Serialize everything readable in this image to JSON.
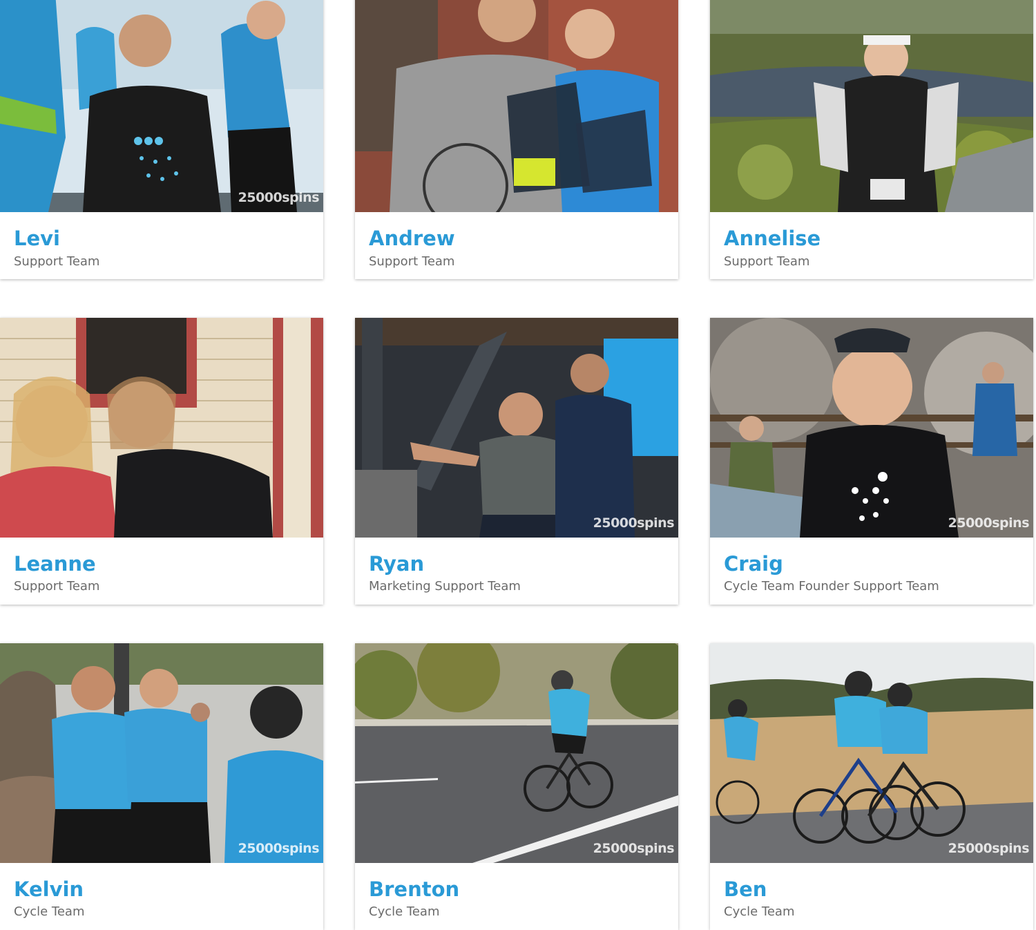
{
  "team": {
    "members": [
      {
        "name": "Levi",
        "role": "Support Team",
        "watermark": "25000spins"
      },
      {
        "name": "Andrew",
        "role": "Support Team",
        "watermark": ""
      },
      {
        "name": "Annelise",
        "role": "Support Team",
        "watermark": ""
      },
      {
        "name": "Leanne",
        "role": "Support Team",
        "watermark": ""
      },
      {
        "name": "Ryan",
        "role": "Marketing Support Team",
        "watermark": "25000spins"
      },
      {
        "name": "Craig",
        "role": "Cycle Team Founder Support Team",
        "watermark": "25000spins"
      },
      {
        "name": "Kelvin",
        "role": "Cycle Team",
        "watermark": "25000spins"
      },
      {
        "name": "Brenton",
        "role": "Cycle Team",
        "watermark": "25000spins"
      },
      {
        "name": "Ben",
        "role": "Cycle Team",
        "watermark": "25000spins"
      }
    ]
  },
  "colors": {
    "name_accent": "#2a9ad6",
    "role_text": "#6b6b6b",
    "card_bg": "#ffffff"
  }
}
